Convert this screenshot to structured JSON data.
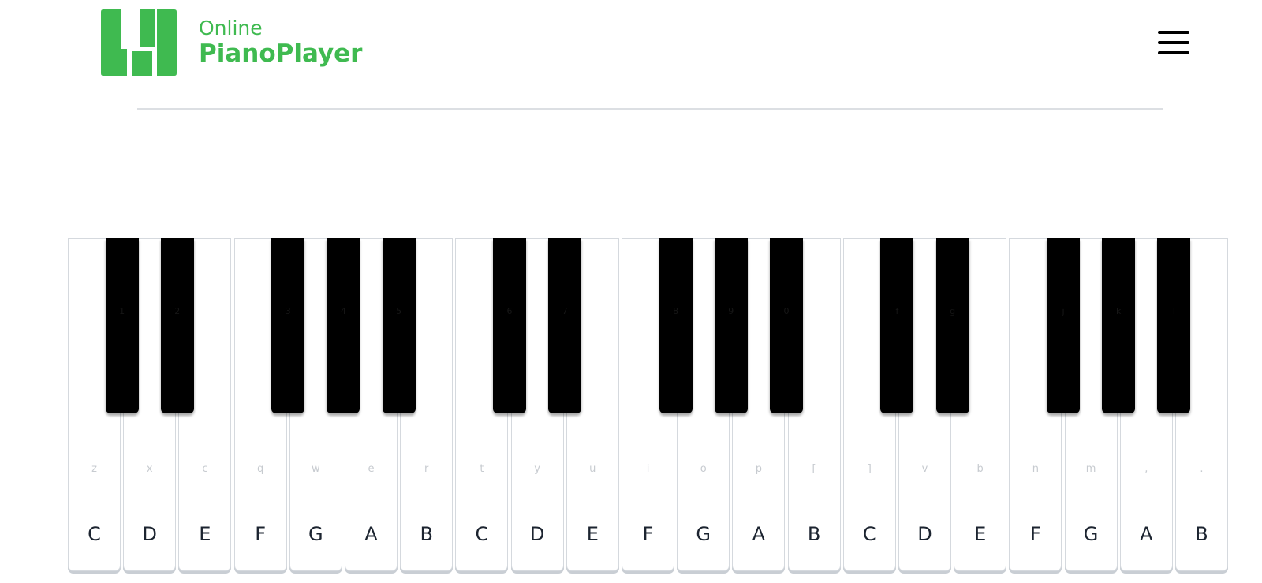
{
  "brand": {
    "line1": "Online",
    "line2": "PianoPlayer",
    "color": "#3fba50",
    "icon": "piano-keys-logo-icon"
  },
  "header": {
    "menu_icon": "hamburger-menu-icon"
  },
  "piano": {
    "white_keys": [
      {
        "note": "C",
        "key": "z"
      },
      {
        "note": "D",
        "key": "x"
      },
      {
        "note": "E",
        "key": "c"
      },
      {
        "note": "F",
        "key": "q"
      },
      {
        "note": "G",
        "key": "w"
      },
      {
        "note": "A",
        "key": "e"
      },
      {
        "note": "B",
        "key": "r"
      },
      {
        "note": "C",
        "key": "t"
      },
      {
        "note": "D",
        "key": "y"
      },
      {
        "note": "E",
        "key": "u"
      },
      {
        "note": "F",
        "key": "i"
      },
      {
        "note": "G",
        "key": "o"
      },
      {
        "note": "A",
        "key": "p"
      },
      {
        "note": "B",
        "key": "["
      },
      {
        "note": "C",
        "key": "]"
      },
      {
        "note": "D",
        "key": "v"
      },
      {
        "note": "E",
        "key": "b"
      },
      {
        "note": "F",
        "key": "n"
      },
      {
        "note": "G",
        "key": "m"
      },
      {
        "note": "A",
        "key": ","
      },
      {
        "note": "B",
        "key": "."
      }
    ],
    "black_keys": [
      {
        "after_white": 0,
        "key": "1"
      },
      {
        "after_white": 1,
        "key": "2"
      },
      {
        "after_white": 3,
        "key": "3"
      },
      {
        "after_white": 4,
        "key": "4"
      },
      {
        "after_white": 5,
        "key": "5"
      },
      {
        "after_white": 7,
        "key": "6"
      },
      {
        "after_white": 8,
        "key": "7"
      },
      {
        "after_white": 10,
        "key": "8"
      },
      {
        "after_white": 11,
        "key": "9"
      },
      {
        "after_white": 12,
        "key": "0"
      },
      {
        "after_white": 14,
        "key": "f"
      },
      {
        "after_white": 15,
        "key": "g"
      },
      {
        "after_white": 17,
        "key": "j"
      },
      {
        "after_white": 18,
        "key": "k"
      },
      {
        "after_white": 19,
        "key": "l"
      }
    ]
  }
}
